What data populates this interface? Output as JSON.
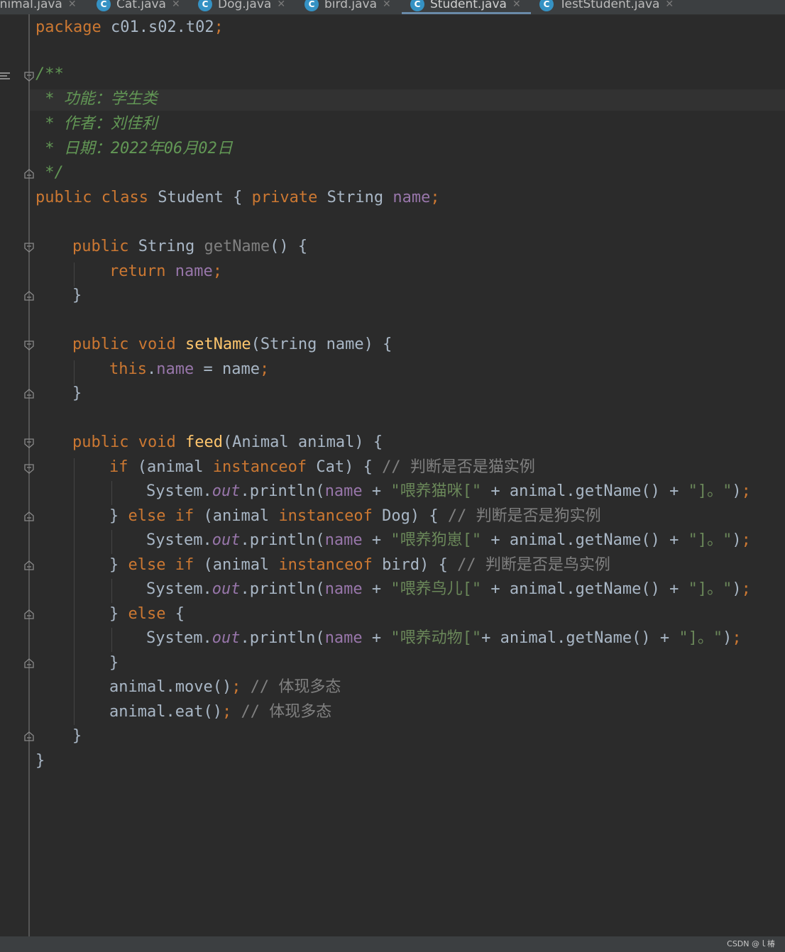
{
  "tabs": [
    {
      "label": "Animal.java",
      "active": false
    },
    {
      "label": "Cat.java",
      "active": false
    },
    {
      "label": "Dog.java",
      "active": false
    },
    {
      "label": "bird.java",
      "active": false
    },
    {
      "label": "Student.java",
      "active": true
    },
    {
      "label": "TestStudent.java",
      "active": false
    }
  ],
  "icons": {
    "class_icon": "java-class-icon",
    "close_icon": "close-icon",
    "fold_icon": "fold-arrow-icon"
  },
  "colors": {
    "background": "#2b2b2b",
    "keyword": "#cc7832",
    "field": "#9876aa",
    "method": "#ffc66d",
    "string": "#6a8759",
    "comment": "#808080",
    "javadoc": "#629755",
    "plain": "#a9b7c6"
  },
  "code": {
    "l01": {
      "t1": "package",
      "t2": " c01.s02.t02",
      "t3": ";"
    },
    "l03": {
      "t1": "/**"
    },
    "l04": {
      "t1": " * 功能：学生类"
    },
    "l05": {
      "t1": " * 作者：刘佳利"
    },
    "l06": {
      "t1": " * 日期：2022年06月02日"
    },
    "l07": {
      "t1": " */"
    },
    "l08": {
      "t1": "public class",
      "t2": " Student { ",
      "t3": "private",
      "t4": " String ",
      "t5": "name",
      "t6": ";"
    },
    "l10": {
      "t1": "public",
      "t2": " String ",
      "t3": "getName",
      "t4": "() {"
    },
    "l11": {
      "t1": "return",
      "t2": " ",
      "t3": "name",
      "t4": ";"
    },
    "l12": {
      "t1": "}"
    },
    "l14": {
      "t1": "public void",
      "t2": " ",
      "t3": "setName",
      "t4": "(String name) {"
    },
    "l15": {
      "t1": "this",
      "t2": ".",
      "t3": "name",
      "t4": " = name",
      "t5": ";"
    },
    "l16": {
      "t1": "}"
    },
    "l18": {
      "t1": "public void",
      "t2": " ",
      "t3": "feed",
      "t4": "(Animal animal) {"
    },
    "l19": {
      "t1": "if",
      "t2": " (animal ",
      "t3": "instanceof",
      "t4": " Cat) { ",
      "t5": "// 判断是否是猫实例"
    },
    "l20": {
      "t1": "System.",
      "t2": "out",
      "t3": ".println(",
      "t4": "name",
      "t5": " + ",
      "t6": "\"喂养猫咪[\"",
      "t7": " + animal.getName() + ",
      "t8": "\"]。\"",
      "t9": ")",
      "t10": ";"
    },
    "l21": {
      "t1": "} ",
      "t2": "else if",
      "t3": " (animal ",
      "t4": "instanceof",
      "t5": " Dog) { ",
      "t6": "// 判断是否是狗实例"
    },
    "l22": {
      "t1": "System.",
      "t2": "out",
      "t3": ".println(",
      "t4": "name",
      "t5": " + ",
      "t6": "\"喂养狗崽[\"",
      "t7": " + animal.getName() + ",
      "t8": "\"]。\"",
      "t9": ")",
      "t10": ";"
    },
    "l23": {
      "t1": "} ",
      "t2": "else if",
      "t3": " (animal ",
      "t4": "instanceof",
      "t5": " bird) { ",
      "t6": "// 判断是否是鸟实例"
    },
    "l24": {
      "t1": "System.",
      "t2": "out",
      "t3": ".println(",
      "t4": "name",
      "t5": " + ",
      "t6": "\"喂养鸟儿[\"",
      "t7": " + animal.getName() + ",
      "t8": "\"]。\"",
      "t9": ")",
      "t10": ";"
    },
    "l25": {
      "t1": "} ",
      "t2": "else",
      "t3": " {"
    },
    "l26": {
      "t1": "System.",
      "t2": "out",
      "t3": ".println(",
      "t4": "name",
      "t5": " + ",
      "t6": "\"喂养动物[\"",
      "t7": "+ animal.getName() + ",
      "t8": "\"]。\"",
      "t9": ")",
      "t10": ";"
    },
    "l27": {
      "t1": "}"
    },
    "l28": {
      "t1": "animal.move()",
      "t2": "; ",
      "t3": "// 体现多态"
    },
    "l29": {
      "t1": "animal.eat()",
      "t2": "; ",
      "t3": "// 体现多态"
    },
    "l30": {
      "t1": "}"
    },
    "l31": {
      "t1": "}"
    }
  },
  "watermark": "CSDN @ｌ椿"
}
